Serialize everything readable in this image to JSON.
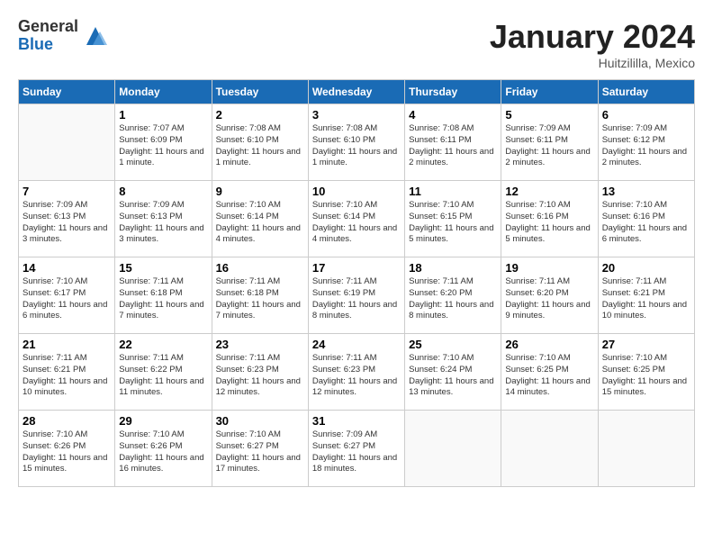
{
  "logo": {
    "general": "General",
    "blue": "Blue"
  },
  "title": "January 2024",
  "location": "Huitzililla, Mexico",
  "days_header": [
    "Sunday",
    "Monday",
    "Tuesday",
    "Wednesday",
    "Thursday",
    "Friday",
    "Saturday"
  ],
  "weeks": [
    [
      {
        "day": "",
        "sunrise": "",
        "sunset": "",
        "daylight": ""
      },
      {
        "day": "1",
        "sunrise": "Sunrise: 7:07 AM",
        "sunset": "Sunset: 6:09 PM",
        "daylight": "Daylight: 11 hours and 1 minute."
      },
      {
        "day": "2",
        "sunrise": "Sunrise: 7:08 AM",
        "sunset": "Sunset: 6:10 PM",
        "daylight": "Daylight: 11 hours and 1 minute."
      },
      {
        "day": "3",
        "sunrise": "Sunrise: 7:08 AM",
        "sunset": "Sunset: 6:10 PM",
        "daylight": "Daylight: 11 hours and 1 minute."
      },
      {
        "day": "4",
        "sunrise": "Sunrise: 7:08 AM",
        "sunset": "Sunset: 6:11 PM",
        "daylight": "Daylight: 11 hours and 2 minutes."
      },
      {
        "day": "5",
        "sunrise": "Sunrise: 7:09 AM",
        "sunset": "Sunset: 6:11 PM",
        "daylight": "Daylight: 11 hours and 2 minutes."
      },
      {
        "day": "6",
        "sunrise": "Sunrise: 7:09 AM",
        "sunset": "Sunset: 6:12 PM",
        "daylight": "Daylight: 11 hours and 2 minutes."
      }
    ],
    [
      {
        "day": "7",
        "sunrise": "Sunrise: 7:09 AM",
        "sunset": "Sunset: 6:13 PM",
        "daylight": "Daylight: 11 hours and 3 minutes."
      },
      {
        "day": "8",
        "sunrise": "Sunrise: 7:09 AM",
        "sunset": "Sunset: 6:13 PM",
        "daylight": "Daylight: 11 hours and 3 minutes."
      },
      {
        "day": "9",
        "sunrise": "Sunrise: 7:10 AM",
        "sunset": "Sunset: 6:14 PM",
        "daylight": "Daylight: 11 hours and 4 minutes."
      },
      {
        "day": "10",
        "sunrise": "Sunrise: 7:10 AM",
        "sunset": "Sunset: 6:14 PM",
        "daylight": "Daylight: 11 hours and 4 minutes."
      },
      {
        "day": "11",
        "sunrise": "Sunrise: 7:10 AM",
        "sunset": "Sunset: 6:15 PM",
        "daylight": "Daylight: 11 hours and 5 minutes."
      },
      {
        "day": "12",
        "sunrise": "Sunrise: 7:10 AM",
        "sunset": "Sunset: 6:16 PM",
        "daylight": "Daylight: 11 hours and 5 minutes."
      },
      {
        "day": "13",
        "sunrise": "Sunrise: 7:10 AM",
        "sunset": "Sunset: 6:16 PM",
        "daylight": "Daylight: 11 hours and 6 minutes."
      }
    ],
    [
      {
        "day": "14",
        "sunrise": "Sunrise: 7:10 AM",
        "sunset": "Sunset: 6:17 PM",
        "daylight": "Daylight: 11 hours and 6 minutes."
      },
      {
        "day": "15",
        "sunrise": "Sunrise: 7:11 AM",
        "sunset": "Sunset: 6:18 PM",
        "daylight": "Daylight: 11 hours and 7 minutes."
      },
      {
        "day": "16",
        "sunrise": "Sunrise: 7:11 AM",
        "sunset": "Sunset: 6:18 PM",
        "daylight": "Daylight: 11 hours and 7 minutes."
      },
      {
        "day": "17",
        "sunrise": "Sunrise: 7:11 AM",
        "sunset": "Sunset: 6:19 PM",
        "daylight": "Daylight: 11 hours and 8 minutes."
      },
      {
        "day": "18",
        "sunrise": "Sunrise: 7:11 AM",
        "sunset": "Sunset: 6:20 PM",
        "daylight": "Daylight: 11 hours and 8 minutes."
      },
      {
        "day": "19",
        "sunrise": "Sunrise: 7:11 AM",
        "sunset": "Sunset: 6:20 PM",
        "daylight": "Daylight: 11 hours and 9 minutes."
      },
      {
        "day": "20",
        "sunrise": "Sunrise: 7:11 AM",
        "sunset": "Sunset: 6:21 PM",
        "daylight": "Daylight: 11 hours and 10 minutes."
      }
    ],
    [
      {
        "day": "21",
        "sunrise": "Sunrise: 7:11 AM",
        "sunset": "Sunset: 6:21 PM",
        "daylight": "Daylight: 11 hours and 10 minutes."
      },
      {
        "day": "22",
        "sunrise": "Sunrise: 7:11 AM",
        "sunset": "Sunset: 6:22 PM",
        "daylight": "Daylight: 11 hours and 11 minutes."
      },
      {
        "day": "23",
        "sunrise": "Sunrise: 7:11 AM",
        "sunset": "Sunset: 6:23 PM",
        "daylight": "Daylight: 11 hours and 12 minutes."
      },
      {
        "day": "24",
        "sunrise": "Sunrise: 7:11 AM",
        "sunset": "Sunset: 6:23 PM",
        "daylight": "Daylight: 11 hours and 12 minutes."
      },
      {
        "day": "25",
        "sunrise": "Sunrise: 7:10 AM",
        "sunset": "Sunset: 6:24 PM",
        "daylight": "Daylight: 11 hours and 13 minutes."
      },
      {
        "day": "26",
        "sunrise": "Sunrise: 7:10 AM",
        "sunset": "Sunset: 6:25 PM",
        "daylight": "Daylight: 11 hours and 14 minutes."
      },
      {
        "day": "27",
        "sunrise": "Sunrise: 7:10 AM",
        "sunset": "Sunset: 6:25 PM",
        "daylight": "Daylight: 11 hours and 15 minutes."
      }
    ],
    [
      {
        "day": "28",
        "sunrise": "Sunrise: 7:10 AM",
        "sunset": "Sunset: 6:26 PM",
        "daylight": "Daylight: 11 hours and 15 minutes."
      },
      {
        "day": "29",
        "sunrise": "Sunrise: 7:10 AM",
        "sunset": "Sunset: 6:26 PM",
        "daylight": "Daylight: 11 hours and 16 minutes."
      },
      {
        "day": "30",
        "sunrise": "Sunrise: 7:10 AM",
        "sunset": "Sunset: 6:27 PM",
        "daylight": "Daylight: 11 hours and 17 minutes."
      },
      {
        "day": "31",
        "sunrise": "Sunrise: 7:09 AM",
        "sunset": "Sunset: 6:27 PM",
        "daylight": "Daylight: 11 hours and 18 minutes."
      },
      {
        "day": "",
        "sunrise": "",
        "sunset": "",
        "daylight": ""
      },
      {
        "day": "",
        "sunrise": "",
        "sunset": "",
        "daylight": ""
      },
      {
        "day": "",
        "sunrise": "",
        "sunset": "",
        "daylight": ""
      }
    ]
  ]
}
